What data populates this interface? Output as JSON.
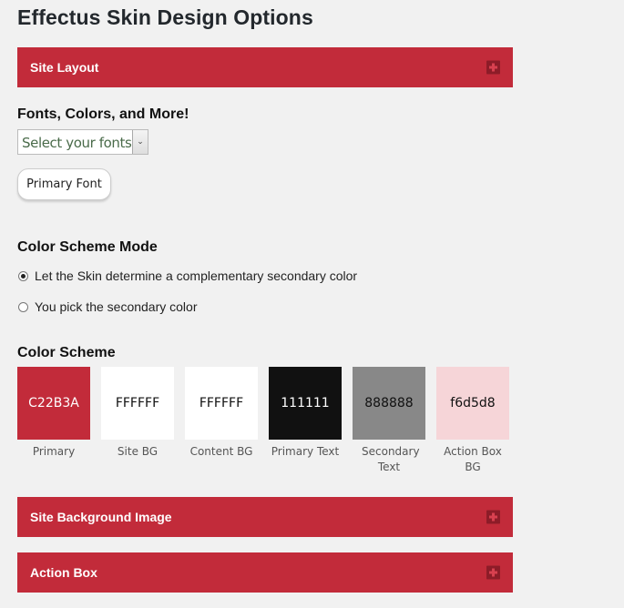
{
  "page": {
    "title": "Effectus Skin Design Options"
  },
  "panels": [
    {
      "label": "Site Layout",
      "icon": "plus-icon"
    },
    {
      "label": "Site Background Image",
      "icon": "plus-icon"
    },
    {
      "label": "Action Box",
      "icon": "plus-icon"
    }
  ],
  "fonts": {
    "heading": "Fonts, Colors, and More!",
    "select_value": "Select your fonts:",
    "select_arrow": "⌄",
    "primary_font_button": "Primary Font"
  },
  "color_mode": {
    "heading": "Color Scheme Mode",
    "options": [
      {
        "label": "Let the Skin determine a complementary secondary color",
        "checked": true
      },
      {
        "label": "You pick the secondary color",
        "checked": false
      }
    ]
  },
  "color_scheme": {
    "heading": "Color Scheme",
    "swatches": [
      {
        "label": "Primary",
        "value": "C22B3A",
        "color": "#c22b3a",
        "text_color": "#ffffff"
      },
      {
        "label": "Site BG",
        "value": "FFFFFF",
        "color": "#ffffff",
        "text_color": "#111111"
      },
      {
        "label": "Content BG",
        "value": "FFFFFF",
        "color": "#ffffff",
        "text_color": "#111111"
      },
      {
        "label": "Primary Text",
        "value": "111111",
        "color": "#111111",
        "text_color": "#ffffff"
      },
      {
        "label": "Secondary Text",
        "value": "888888",
        "color": "#888888",
        "text_color": "#111111"
      },
      {
        "label": "Action Box BG",
        "value": "f6d5d8",
        "color": "#f6d5d8",
        "text_color": "#111111"
      }
    ]
  },
  "theme": {
    "accent": "#c22b3a",
    "accent_dark": "#8d1c28",
    "background": "#f1f1f1"
  }
}
